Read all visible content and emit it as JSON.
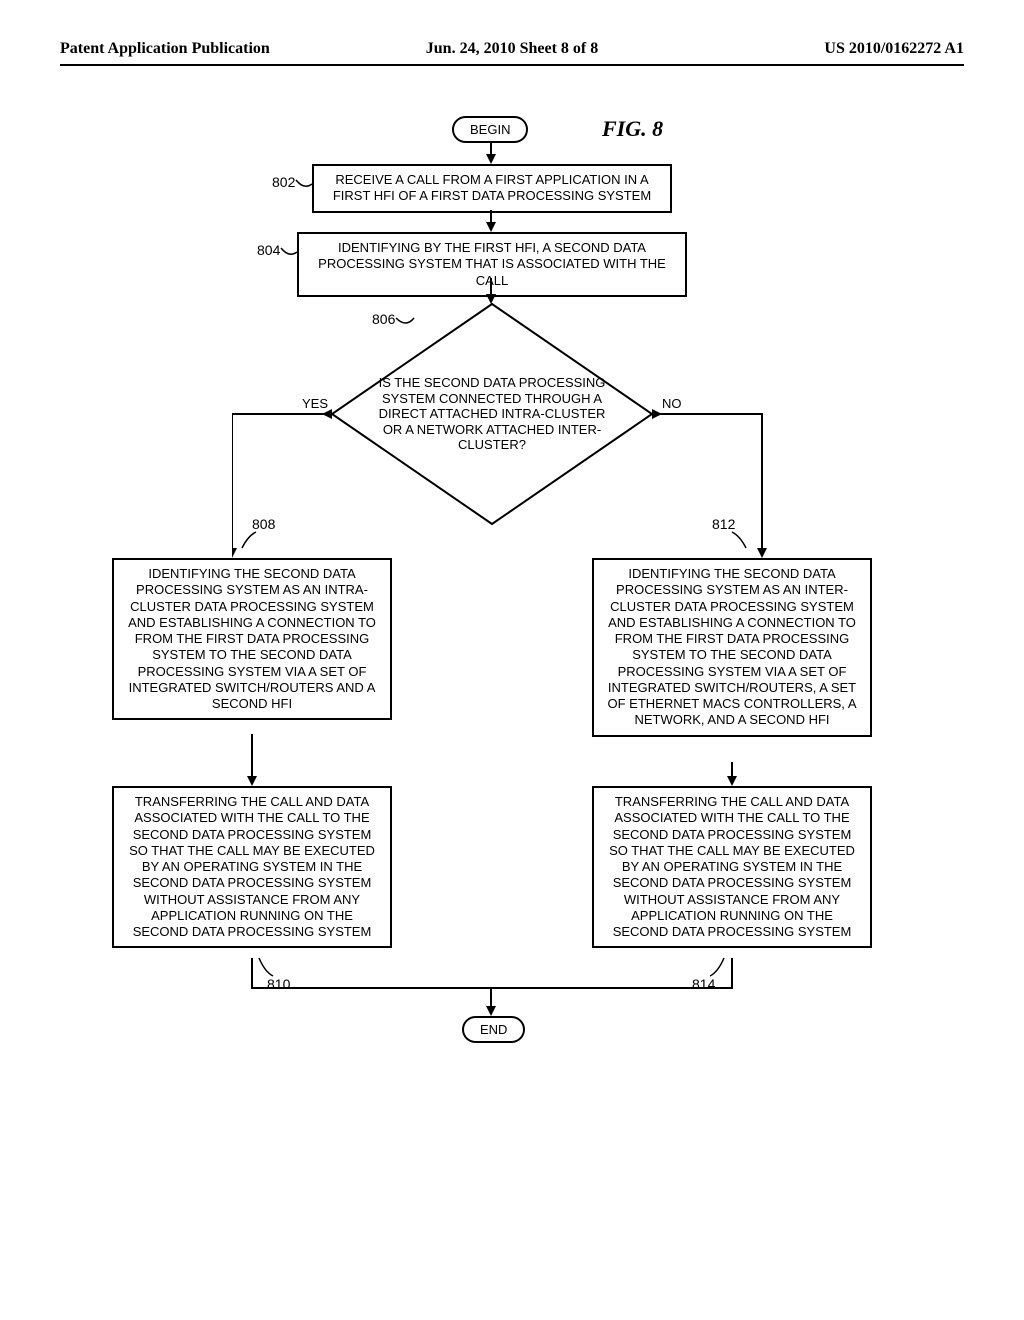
{
  "header": {
    "left": "Patent Application Publication",
    "center": "Jun. 24, 2010  Sheet 8 of 8",
    "right": "US 2010/0162272 A1"
  },
  "figure_label": "FIG. 8",
  "terminals": {
    "begin": "BEGIN",
    "end": "END"
  },
  "labels": {
    "yes": "YES",
    "no": "NO"
  },
  "refs": {
    "r802": "802",
    "r804": "804",
    "r806": "806",
    "r808": "808",
    "r810": "810",
    "r812": "812",
    "r814": "814"
  },
  "steps": {
    "s802": "RECEIVE A CALL FROM A FIRST APPLICATION IN A FIRST HFI OF A FIRST DATA PROCESSING SYSTEM",
    "s804": "IDENTIFYING BY THE FIRST HFI, A SECOND DATA PROCESSING SYSTEM THAT IS ASSOCIATED WITH THE CALL",
    "s806": "IS THE SECOND DATA PROCESSING SYSTEM CONNECTED THROUGH A DIRECT ATTACHED INTRA-CLUSTER OR A NETWORK ATTACHED INTER-CLUSTER?",
    "s808": "IDENTIFYING THE SECOND DATA PROCESSING SYSTEM AS AN INTRA-CLUSTER DATA PROCESSING SYSTEM AND ESTABLISHING A CONNECTION TO FROM THE FIRST DATA PROCESSING SYSTEM TO THE SECOND DATA PROCESSING SYSTEM VIA A SET OF INTEGRATED SWITCH/ROUTERS AND A SECOND HFI",
    "s810": "TRANSFERRING THE CALL AND DATA ASSOCIATED WITH THE CALL TO THE SECOND DATA PROCESSING SYSTEM SO THAT THE CALL MAY BE EXECUTED BY AN OPERATING SYSTEM IN THE SECOND DATA PROCESSING SYSTEM WITHOUT ASSISTANCE FROM ANY APPLICATION RUNNING ON THE SECOND DATA PROCESSING SYSTEM",
    "s812": "IDENTIFYING THE SECOND DATA PROCESSING SYSTEM AS AN INTER-CLUSTER DATA PROCESSING SYSTEM AND ESTABLISHING A CONNECTION TO FROM THE FIRST DATA PROCESSING SYSTEM TO THE SECOND DATA PROCESSING SYSTEM VIA A SET OF INTEGRATED SWITCH/ROUTERS, A SET OF ETHERNET MACS CONTROLLERS, A NETWORK, AND A SECOND HFI",
    "s814": "TRANSFERRING THE CALL AND DATA ASSOCIATED WITH THE CALL TO THE SECOND DATA PROCESSING SYSTEM SO THAT THE CALL MAY BE EXECUTED BY AN OPERATING SYSTEM IN THE SECOND DATA PROCESSING SYSTEM WITHOUT ASSISTANCE FROM ANY APPLICATION RUNNING ON THE SECOND DATA PROCESSING SYSTEM"
  }
}
